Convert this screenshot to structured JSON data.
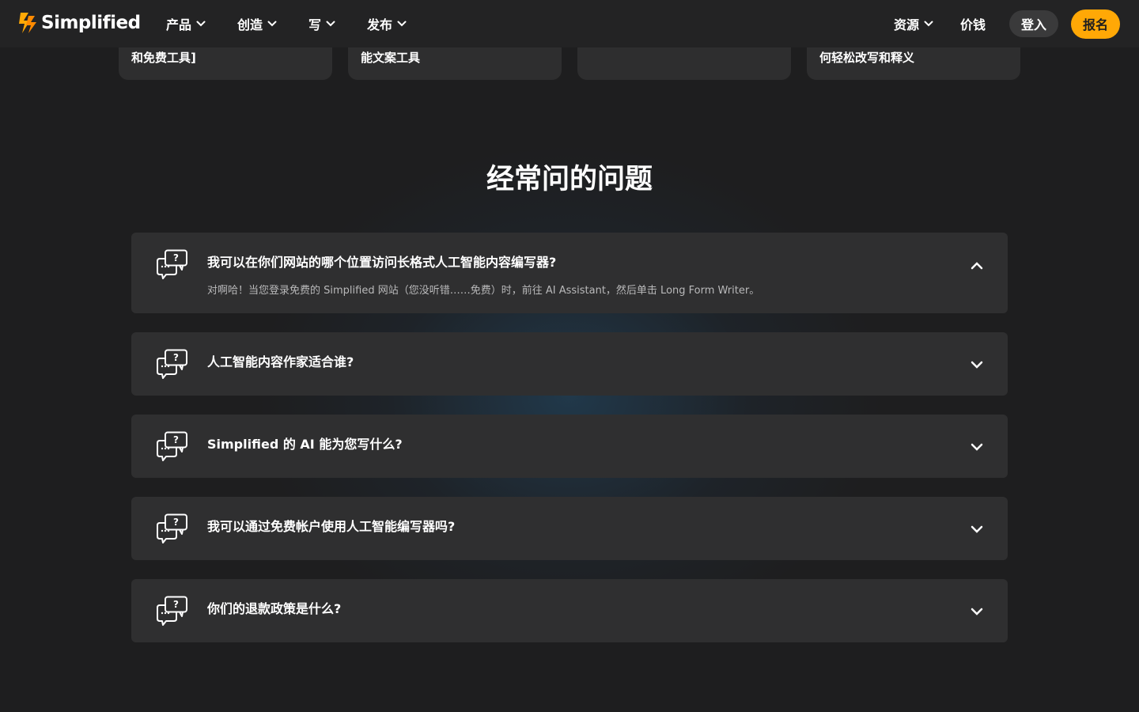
{
  "brand": {
    "name": "Simplified",
    "accent": "#ffa806"
  },
  "nav": {
    "menu": [
      {
        "label": "产品"
      },
      {
        "label": "创造"
      },
      {
        "label": "写"
      },
      {
        "label": "发布"
      }
    ],
    "resources_label": "资源",
    "pricing_label": "价钱",
    "login_label": "登入",
    "signup_label": "报名"
  },
  "cards": [
    {
      "text": "和免费工具]"
    },
    {
      "text": "能文案工具"
    },
    {
      "text": ""
    },
    {
      "text": "何轻松改写和释义"
    }
  ],
  "faq": {
    "title": "经常问的问题",
    "items": [
      {
        "question": "我可以在你们网站的哪个位置访问长格式人工智能内容编写器?",
        "answer": "对啊哈！当您登录免费的 Simplified 网站（您没听错……免费）时，前往 AI Assistant，然后单击 Long Form Writer。",
        "expanded": true
      },
      {
        "question": "人工智能内容作家适合谁?",
        "expanded": false
      },
      {
        "question": "Simplified 的 AI 能为您写什么?",
        "expanded": false
      },
      {
        "question": "我可以通过免费帐户使用人工智能编写器吗?",
        "expanded": false
      },
      {
        "question": "你们的退款政策是什么?",
        "expanded": false
      }
    ]
  }
}
